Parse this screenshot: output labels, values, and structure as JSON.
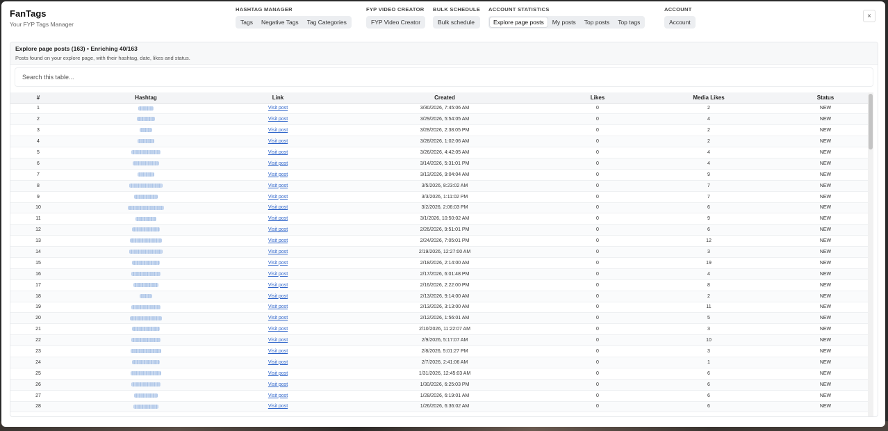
{
  "app": {
    "title": "FanTags",
    "subtitle": "Your FYP Tags Manager"
  },
  "nav": {
    "groups": [
      {
        "label": "HASHTAG MANAGER",
        "items": [
          "Tags",
          "Negative Tags",
          "Tag Categories"
        ]
      },
      {
        "label": "FYP VIDEO CREATOR",
        "items": [
          "FYP Video Creator"
        ]
      },
      {
        "label": "BULK SCHEDULE",
        "items": [
          "Bulk schedule"
        ]
      },
      {
        "label": "ACCOUNT STATISTICS",
        "items": [
          "Explore page posts",
          "My posts",
          "Top posts",
          "Top tags"
        ]
      },
      {
        "label": "ACCOUNT",
        "items": [
          "Account"
        ]
      }
    ],
    "active": "Explore page posts"
  },
  "close_label": "×",
  "panel": {
    "title": "Explore page posts (163) • Enriching 40/163",
    "description": "Posts found on your explore page, with their hashtag, date, likes and status."
  },
  "search": {
    "placeholder": "Search this table..."
  },
  "table": {
    "columns": [
      "#",
      "Hashtag",
      "Link",
      "Created",
      "Likes",
      "Media Likes",
      "Status"
    ],
    "rows": [
      {
        "n": "1",
        "link": "Visit post",
        "created": "3/30/2026, 7:45:06 AM",
        "likes": "0",
        "media_likes": "2",
        "status": "NEW"
      },
      {
        "n": "2",
        "link": "Visit post",
        "created": "3/29/2026, 5:54:05 AM",
        "likes": "0",
        "media_likes": "4",
        "status": "NEW"
      },
      {
        "n": "3",
        "link": "Visit post",
        "created": "3/28/2026, 2:38:05 PM",
        "likes": "0",
        "media_likes": "2",
        "status": "NEW"
      },
      {
        "n": "4",
        "link": "Visit post",
        "created": "3/28/2026, 1:02:06 AM",
        "likes": "0",
        "media_likes": "2",
        "status": "NEW"
      },
      {
        "n": "5",
        "link": "Visit post",
        "created": "3/26/2026, 4:42:05 AM",
        "likes": "0",
        "media_likes": "4",
        "status": "NEW"
      },
      {
        "n": "6",
        "link": "Visit post",
        "created": "3/14/2026, 5:31:01 PM",
        "likes": "0",
        "media_likes": "4",
        "status": "NEW"
      },
      {
        "n": "7",
        "link": "Visit post",
        "created": "3/13/2026, 9:04:04 AM",
        "likes": "0",
        "media_likes": "9",
        "status": "NEW"
      },
      {
        "n": "8",
        "link": "Visit post",
        "created": "3/5/2026, 8:23:02 AM",
        "likes": "0",
        "media_likes": "7",
        "status": "NEW"
      },
      {
        "n": "9",
        "link": "Visit post",
        "created": "3/3/2026, 1:11:02 PM",
        "likes": "0",
        "media_likes": "7",
        "status": "NEW"
      },
      {
        "n": "10",
        "link": "Visit post",
        "created": "3/2/2026, 2:06:03 PM",
        "likes": "0",
        "media_likes": "6",
        "status": "NEW"
      },
      {
        "n": "11",
        "link": "Visit post",
        "created": "3/1/2026, 10:50:02 AM",
        "likes": "0",
        "media_likes": "9",
        "status": "NEW"
      },
      {
        "n": "12",
        "link": "Visit post",
        "created": "2/26/2026, 9:51:01 PM",
        "likes": "0",
        "media_likes": "6",
        "status": "NEW"
      },
      {
        "n": "13",
        "link": "Visit post",
        "created": "2/24/2026, 7:05:01 PM",
        "likes": "0",
        "media_likes": "12",
        "status": "NEW"
      },
      {
        "n": "14",
        "link": "Visit post",
        "created": "2/19/2026, 12:27:00 AM",
        "likes": "0",
        "media_likes": "3",
        "status": "NEW"
      },
      {
        "n": "15",
        "link": "Visit post",
        "created": "2/18/2026, 2:14:00 AM",
        "likes": "0",
        "media_likes": "19",
        "status": "NEW"
      },
      {
        "n": "16",
        "link": "Visit post",
        "created": "2/17/2026, 6:01:48 PM",
        "likes": "0",
        "media_likes": "4",
        "status": "NEW"
      },
      {
        "n": "17",
        "link": "Visit post",
        "created": "2/16/2026, 2:22:00 PM",
        "likes": "0",
        "media_likes": "8",
        "status": "NEW"
      },
      {
        "n": "18",
        "link": "Visit post",
        "created": "2/13/2026, 9:14:00 AM",
        "likes": "0",
        "media_likes": "2",
        "status": "NEW"
      },
      {
        "n": "19",
        "link": "Visit post",
        "created": "2/13/2026, 3:13:00 AM",
        "likes": "0",
        "media_likes": "11",
        "status": "NEW"
      },
      {
        "n": "20",
        "link": "Visit post",
        "created": "2/12/2026, 1:56:01 AM",
        "likes": "0",
        "media_likes": "5",
        "status": "NEW"
      },
      {
        "n": "21",
        "link": "Visit post",
        "created": "2/10/2026, 11:22:07 AM",
        "likes": "0",
        "media_likes": "3",
        "status": "NEW"
      },
      {
        "n": "22",
        "link": "Visit post",
        "created": "2/9/2026, 5:17:07 AM",
        "likes": "0",
        "media_likes": "10",
        "status": "NEW"
      },
      {
        "n": "23",
        "link": "Visit post",
        "created": "2/8/2026, 5:01:27 PM",
        "likes": "0",
        "media_likes": "3",
        "status": "NEW"
      },
      {
        "n": "24",
        "link": "Visit post",
        "created": "2/7/2026, 2:41:06 AM",
        "likes": "0",
        "media_likes": "1",
        "status": "NEW"
      },
      {
        "n": "25",
        "link": "Visit post",
        "created": "1/31/2026, 12:45:03 AM",
        "likes": "0",
        "media_likes": "6",
        "status": "NEW"
      },
      {
        "n": "26",
        "link": "Visit post",
        "created": "1/30/2026, 6:25:03 PM",
        "likes": "0",
        "media_likes": "6",
        "status": "NEW"
      },
      {
        "n": "27",
        "link": "Visit post",
        "created": "1/28/2026, 6:19:01 AM",
        "likes": "0",
        "media_likes": "6",
        "status": "NEW"
      },
      {
        "n": "28",
        "link": "Visit post",
        "created": "1/26/2026, 6:36:02 AM",
        "likes": "0",
        "media_likes": "6",
        "status": "NEW"
      }
    ]
  },
  "colors": {
    "link": "#2b62c9",
    "header_bg": "#f3f4f6",
    "nav_bg": "#eceef1"
  }
}
